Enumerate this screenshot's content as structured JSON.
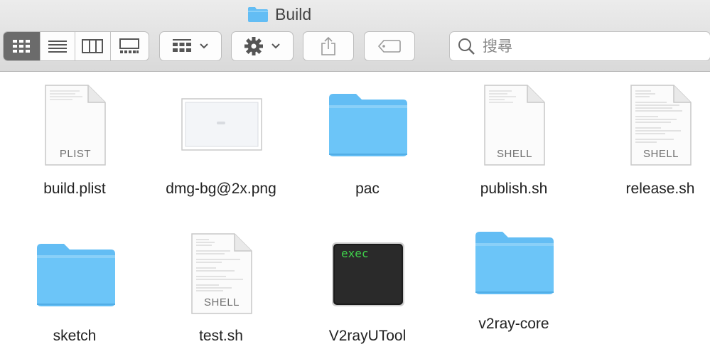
{
  "window": {
    "title": "Build",
    "title_icon": "folder-icon"
  },
  "toolbar": {
    "view_buttons": [
      "icon-view-icon",
      "list-view-icon",
      "column-view-icon",
      "gallery-view-icon"
    ],
    "selected_view": "icon-view",
    "group_icon": "group-by-icon",
    "action_icon": "gear-icon",
    "share_icon": "share-icon",
    "tag_icon": "tag-icon"
  },
  "search": {
    "placeholder": "搜尋",
    "value": ""
  },
  "files": [
    {
      "name": "build.plist",
      "kind": "document",
      "badge": "PLIST"
    },
    {
      "name": "dmg-bg@2x.png",
      "kind": "image",
      "badge": ""
    },
    {
      "name": "pac",
      "kind": "folder",
      "badge": ""
    },
    {
      "name": "publish.sh",
      "kind": "document",
      "badge": "SHELL"
    },
    {
      "name": "release.sh",
      "kind": "document",
      "badge": "SHELL"
    },
    {
      "name": "sketch",
      "kind": "folder",
      "badge": ""
    },
    {
      "name": "test.sh",
      "kind": "document",
      "badge": "SHELL"
    },
    {
      "name": "V2rayUTool",
      "kind": "executable",
      "badge": "exec"
    },
    {
      "name": "v2ray-core",
      "kind": "folder",
      "badge": ""
    }
  ],
  "colors": {
    "folder": "#63bdf4",
    "folder_tab": "#8ad0f8",
    "exec_text": "#3fd24b",
    "selected_segment": "#6b6b6b"
  }
}
